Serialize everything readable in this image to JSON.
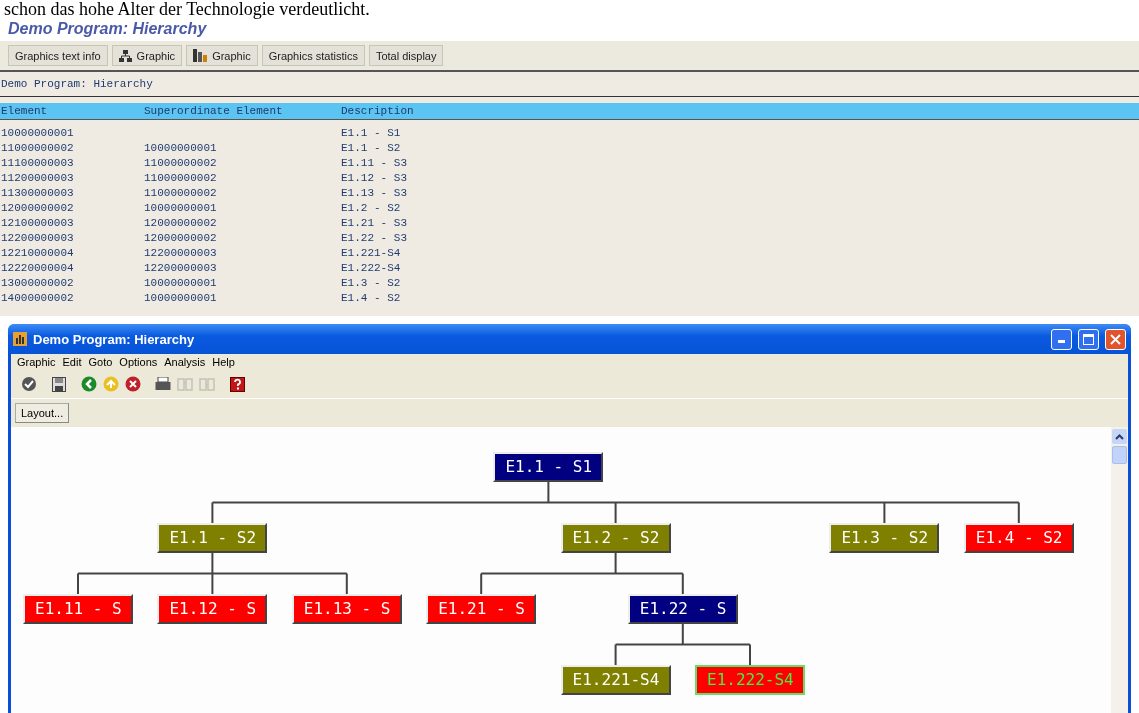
{
  "document_text": "schon das hohe Alter der Technologie verdeutlicht.",
  "page_title": "Demo Program: Hierarchy",
  "toolbar": [
    {
      "label": "Graphics text info",
      "kind": "text"
    },
    {
      "label": "Graphic",
      "kind": "hierarchy"
    },
    {
      "label": "Graphic",
      "kind": "chart"
    },
    {
      "label": "Graphics statistics",
      "kind": "text"
    },
    {
      "label": "Total display",
      "kind": "text"
    }
  ],
  "list": {
    "title": "Demo Program: Hierarchy",
    "columns": [
      "Element",
      "Superordinate Element",
      "Description"
    ],
    "rows": [
      {
        "element": "10000000001",
        "description": "E1.1 - S1"
      },
      {
        "element": "11000000002",
        "superordinate": "10000000001",
        "description": "E1.1 - S2"
      },
      {
        "element": "11100000003",
        "superordinate": "11000000002",
        "description": "E1.11 - S3"
      },
      {
        "element": "11200000003",
        "superordinate": "11000000002",
        "description": "E1.12 - S3"
      },
      {
        "element": "11300000003",
        "superordinate": "11000000002",
        "description": "E1.13 - S3"
      },
      {
        "element": "12000000002",
        "superordinate": "10000000001",
        "description": "E1.2 - S2"
      },
      {
        "element": "12100000003",
        "superordinate": "12000000002",
        "description": "E1.21 - S3"
      },
      {
        "element": "12200000003",
        "superordinate": "12000000002",
        "description": "E1.22 - S3"
      },
      {
        "element": "12210000004",
        "superordinate": "12200000003",
        "description": "E1.221-S4"
      },
      {
        "element": "12220000004",
        "superordinate": "12200000003",
        "description": "E1.222-S4"
      },
      {
        "element": "13000000002",
        "superordinate": "10000000001",
        "description": "E1.3 - S2"
      },
      {
        "element": "14000000002",
        "superordinate": "10000000001",
        "description": "E1.4 - S2"
      }
    ]
  },
  "window": {
    "title": "Demo Program: Hierarchy",
    "menu": [
      "Graphic",
      "Edit",
      "Goto",
      "Options",
      "Analysis",
      "Help"
    ],
    "toolbar": [
      [
        {
          "kind": "check",
          "disabled": false
        }
      ],
      [
        {
          "kind": "save",
          "disabled": false
        }
      ],
      [
        {
          "kind": "back",
          "disabled": false
        },
        {
          "kind": "up",
          "disabled": false
        },
        {
          "kind": "cancel",
          "disabled": false
        }
      ],
      [
        {
          "kind": "print",
          "disabled": false
        },
        {
          "kind": "find",
          "disabled": true
        },
        {
          "kind": "find-next",
          "disabled": true
        }
      ],
      [
        {
          "kind": "help",
          "disabled": false
        }
      ]
    ],
    "layout_button": "Layout...",
    "tree": {
      "label": "E1.1 - S1",
      "color": "#000080",
      "selected": false,
      "children": [
        {
          "label": "E1.1 - S2",
          "color": "#808000",
          "selected": false,
          "children": [
            {
              "label": "E1.11 - S",
              "color": "#ff0000",
              "selected": false
            },
            {
              "label": "E1.12 - S",
              "color": "#ff0000",
              "selected": false
            },
            {
              "label": "E1.13 - S",
              "color": "#ff0000",
              "selected": false
            }
          ]
        },
        {
          "label": "E1.2 - S2",
          "color": "#808000",
          "selected": false,
          "children": [
            {
              "label": "E1.21 - S",
              "color": "#ff0000",
              "selected": false
            },
            {
              "label": "E1.22 - S",
              "color": "#000080",
              "selected": false,
              "children": [
                {
                  "label": "E1.221-S4",
                  "color": "#808000",
                  "selected": false
                },
                {
                  "label": "E1.222-S4",
                  "color": "#ff0000",
                  "selected": true
                }
              ]
            }
          ]
        },
        {
          "label": "E1.3 - S2",
          "color": "#808000",
          "selected": false
        },
        {
          "label": "E1.4 - S2",
          "color": "#ff0000",
          "selected": false
        }
      ]
    }
  }
}
